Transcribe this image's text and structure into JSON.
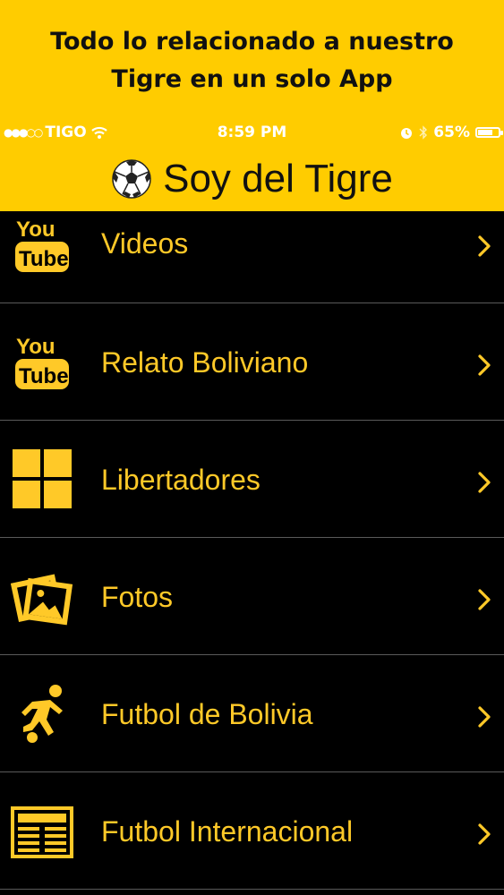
{
  "promo": {
    "line1": "Todo lo relacionado a nuestro",
    "line2": "Tigre en un solo App"
  },
  "statusbar": {
    "carrier": "TIGO",
    "time": "8:59 PM",
    "battery": "65%",
    "battery_level": 0.65
  },
  "navbar": {
    "title": "Soy del Tigre"
  },
  "icons": {
    "youtube_top": "You",
    "youtube_bottom": "Tube"
  },
  "menu": [
    {
      "label": "Videos",
      "icon": "youtube-icon"
    },
    {
      "label": "Relato Boliviano",
      "icon": "youtube-icon"
    },
    {
      "label": "Libertadores",
      "icon": "grid-icon"
    },
    {
      "label": "Fotos",
      "icon": "photos-icon"
    },
    {
      "label": "Futbol de Bolivia",
      "icon": "soccer-player-icon"
    },
    {
      "label": "Futbol Internacional",
      "icon": "newspaper-icon"
    }
  ],
  "colors": {
    "accent": "#FFCC00",
    "label": "#FFC928",
    "background": "#000000"
  }
}
